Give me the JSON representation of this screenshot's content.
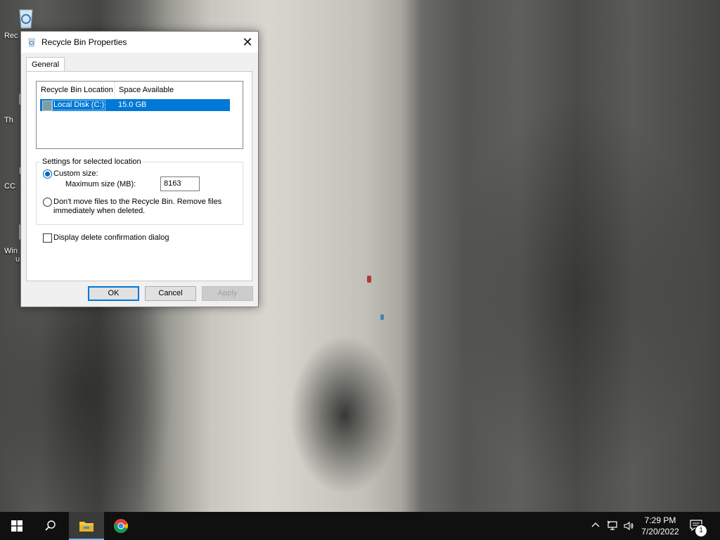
{
  "desktop": {
    "icons": [
      {
        "label": "Rec",
        "icon": "recycle-bin-icon"
      },
      {
        "label": "Th",
        "icon": "this-pc-icon"
      },
      {
        "label": "CC",
        "icon": "ccleaner-shortcut-icon"
      },
      {
        "label": "Win",
        "label2": "u",
        "icon": "windows-update-icon"
      }
    ]
  },
  "dialog": {
    "title": "Recycle Bin Properties",
    "close_label": "✕",
    "tabs": [
      {
        "label": "General"
      }
    ],
    "list": {
      "columns": [
        "Recycle Bin Location",
        "Space Available"
      ],
      "rows": [
        {
          "location": "Local Disk (C:)",
          "space": "15.0 GB",
          "selected": true
        }
      ]
    },
    "settings": {
      "group_label": "Settings for selected location",
      "custom_size_label": "Custom size:",
      "custom_size_checked": true,
      "max_size_label": "Maximum size (MB):",
      "max_size_value": "8163",
      "no_move_label": "Don't move files to the Recycle Bin. Remove files immediately when deleted.",
      "no_move_checked": false
    },
    "confirm_label": "Display delete confirmation dialog",
    "confirm_checked": false,
    "buttons": {
      "ok": "OK",
      "cancel": "Cancel",
      "apply": "Apply"
    }
  },
  "taskbar": {
    "apps": [
      {
        "name": "start",
        "icon": "windows-logo-icon"
      },
      {
        "name": "search",
        "icon": "search-icon"
      },
      {
        "name": "file-explorer",
        "icon": "folder-icon",
        "active": true
      },
      {
        "name": "chrome",
        "icon": "chrome-icon"
      }
    ],
    "tray": {
      "time": "7:29 PM",
      "date": "7/20/2022",
      "notification_count": "1"
    }
  },
  "colors": {
    "accent": "#0078d7",
    "selection": "#0078d7",
    "taskbar": "#101010",
    "dialog_bg": "#f0f0f0"
  }
}
